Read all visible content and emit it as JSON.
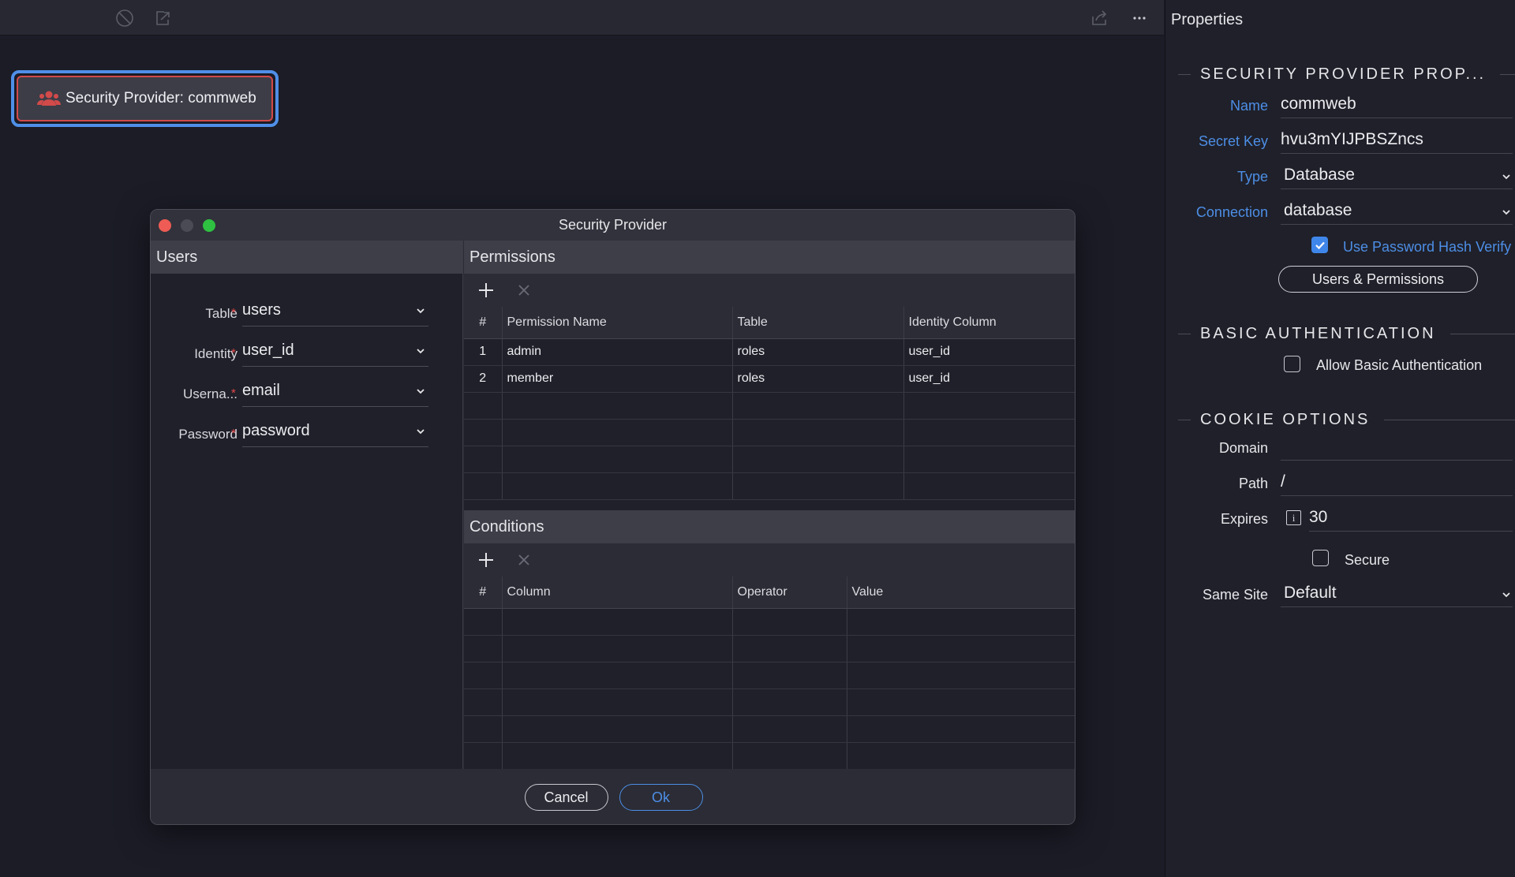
{
  "canvas": {
    "node_label": "Security Provider: commweb"
  },
  "dialog": {
    "title": "Security Provider",
    "users": {
      "header": "Users",
      "fields": [
        {
          "label": "Table",
          "value": "users"
        },
        {
          "label": "Identity",
          "value": "user_id"
        },
        {
          "label": "Userna...",
          "value": "email"
        },
        {
          "label": "Password",
          "value": "password"
        }
      ],
      "required_mark": "*"
    },
    "permissions": {
      "header": "Permissions",
      "columns": [
        "#",
        "Permission Name",
        "Table",
        "Identity Column"
      ],
      "rows": [
        {
          "num": "1",
          "name": "admin",
          "table": "roles",
          "identity": "user_id"
        },
        {
          "num": "2",
          "name": "member",
          "table": "roles",
          "identity": "user_id"
        }
      ]
    },
    "conditions": {
      "header": "Conditions",
      "columns": [
        "#",
        "Column",
        "Operator",
        "Value"
      ]
    },
    "buttons": {
      "cancel": "Cancel",
      "ok": "Ok"
    }
  },
  "properties": {
    "header": "Properties",
    "security_group": "SECURITY PROVIDER PROP...",
    "name_label": "Name",
    "name_value": "commweb",
    "secret_label": "Secret Key",
    "secret_value": "hvu3mYIJPBSZncs",
    "type_label": "Type",
    "type_value": "Database",
    "connection_label": "Connection",
    "connection_value": "database",
    "hash_label": "Use Password Hash Verify",
    "hash_checked": true,
    "users_perm_button": "Users & Permissions",
    "basic_group": "BASIC AUTHENTICATION",
    "allow_basic_label": "Allow Basic Authentication",
    "allow_basic_checked": false,
    "cookie_group": "COOKIE OPTIONS",
    "domain_label": "Domain",
    "domain_value": "",
    "path_label": "Path",
    "path_value": "/",
    "expires_label": "Expires",
    "expires_value": "30",
    "info_glyph": "i",
    "secure_label": "Secure",
    "secure_checked": false,
    "same_site_label": "Same Site",
    "same_site_value": "Default"
  },
  "colors": {
    "accent": "#4d8ee6",
    "required": "#e24848",
    "node_icon": "#d24a4a"
  }
}
